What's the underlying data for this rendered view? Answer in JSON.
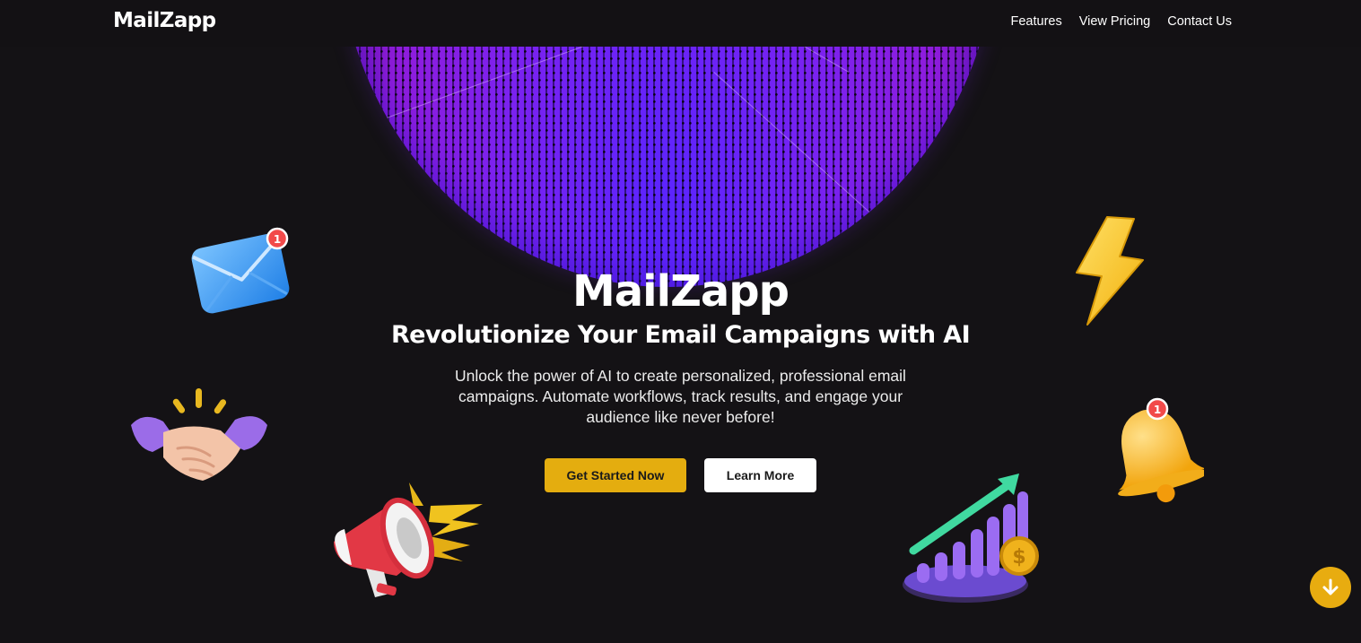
{
  "nav": {
    "brand": "MailZapp",
    "links": [
      {
        "label": "Features"
      },
      {
        "label": "View Pricing"
      },
      {
        "label": "Contact Us"
      }
    ]
  },
  "hero": {
    "title": "MailZapp",
    "subtitle": "Revolutionize Your Email Campaigns with AI",
    "description": "Unlock the power of AI to create personalized, professional email campaigns. Automate workflows, track results, and engage your audience like never before!",
    "primary_cta": "Get Started Now",
    "secondary_cta": "Learn More"
  },
  "floating_icons": {
    "envelope_badge": "1",
    "bell_badge": "1",
    "coin_symbol": "$"
  },
  "icons": [
    "envelope-icon",
    "handshake-icon",
    "megaphone-icon",
    "growth-chart-icon",
    "lightning-bolt-icon",
    "bell-icon",
    "arrow-down-icon"
  ],
  "colors": {
    "background": "#141215",
    "accent_yellow": "#e4ad0f",
    "globe_purple": "#7a22f0",
    "text": "#ffffff"
  }
}
